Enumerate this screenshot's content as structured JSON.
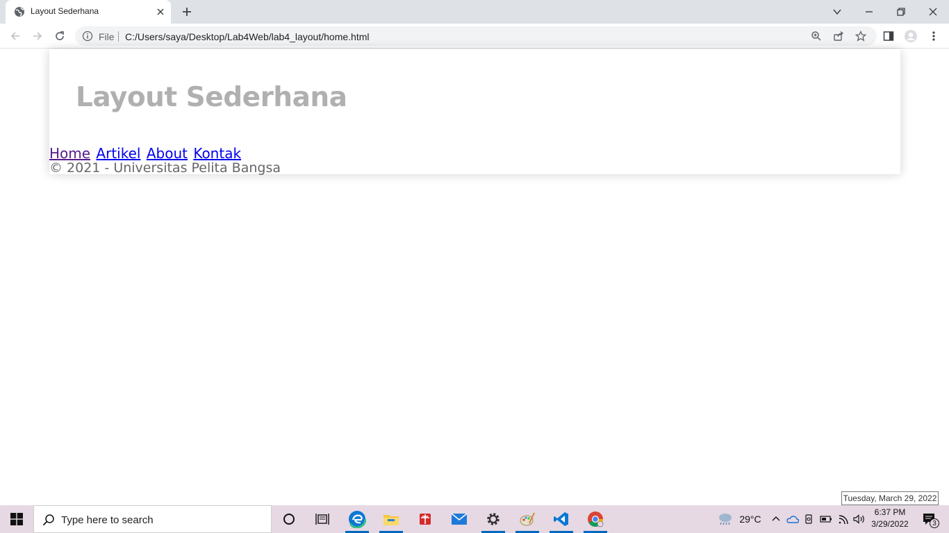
{
  "browser": {
    "tab_title": "Layout Sederhana",
    "omnibox": {
      "security_label": "File",
      "url": "C:/Users/saya/Desktop/Lab4Web/lab4_layout/home.html"
    }
  },
  "page": {
    "site_title": "Layout Sederhana",
    "nav": [
      {
        "label": "Home",
        "visited": true
      },
      {
        "label": "Artikel",
        "visited": false
      },
      {
        "label": "About",
        "visited": false
      },
      {
        "label": "Kontak",
        "visited": false
      }
    ],
    "footer": "© 2021 - Universitas Pelita Bangsa"
  },
  "tooltip": "Tuesday, March 29, 2022",
  "taskbar": {
    "search_placeholder": "Type here to search",
    "apps": [
      "cortana-icon",
      "task-view-icon",
      "edge-icon",
      "file-explorer-icon",
      "gift-app-icon",
      "mail-icon",
      "settings-icon",
      "paint-icon",
      "vscode-icon",
      "chrome-icon"
    ],
    "weather": "29°C",
    "time": "6:37 PM",
    "date": "3/29/2022",
    "notifications": "3"
  },
  "colors": {
    "accent": "#0067c0",
    "taskbar_bg": "#e6d9e3",
    "title_gray": "#b0b0b0",
    "link": "#0000ee",
    "visited_link": "#551a8b"
  }
}
